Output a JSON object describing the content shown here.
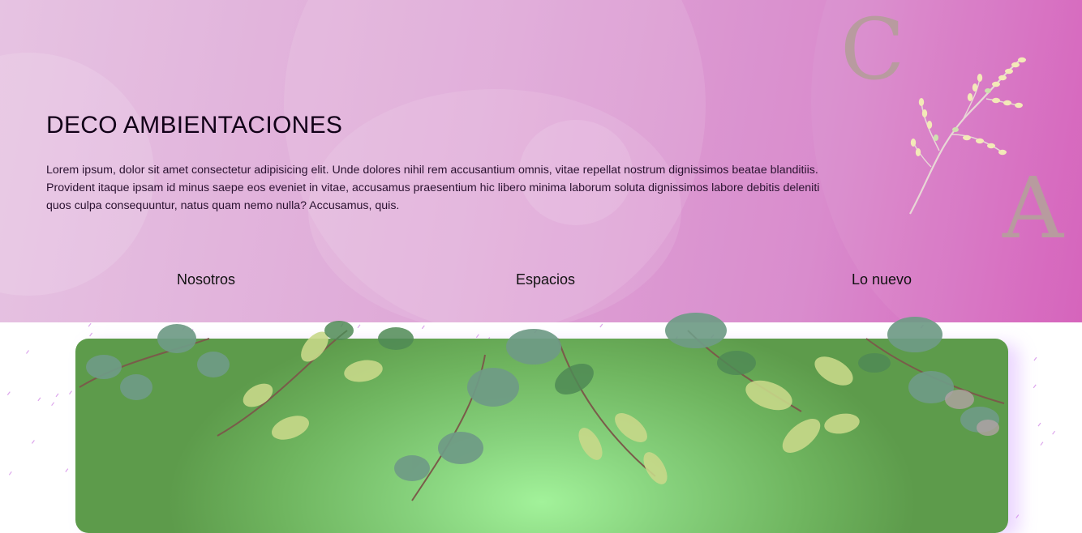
{
  "hero": {
    "title": "DECO AMBIENTACIONES",
    "intro": "Lorem ipsum, dolor sit amet consectetur adipisicing elit. Unde dolores nihil rem accusantium omnis, vitae repellat nostrum dignissimos beatae blanditiis. Provident itaque ipsam id minus saepe eos eveniet in vitae, accusamus praesentium hic libero minima laborum soluta dignissimos labore debitis deleniti quos culpa consequuntur, natus quam nemo nulla? Accusamus, quis.",
    "logo": {
      "letter_top": "C",
      "letter_bottom": "A",
      "icon": "leafy-branch-icon"
    }
  },
  "nav": {
    "items": [
      {
        "label": "Nosotros"
      },
      {
        "label": "Espacios"
      },
      {
        "label": "Lo nuevo"
      }
    ]
  },
  "banner": {
    "image": "watercolor-leaves-garland"
  },
  "colors": {
    "hero_start": "#e6c3e2",
    "hero_end": "#d45cb9",
    "panel_green": "#86d17c",
    "panel_green_dark": "#5d9b4b",
    "confetti": "#c66be0",
    "title_text": "#120018"
  }
}
